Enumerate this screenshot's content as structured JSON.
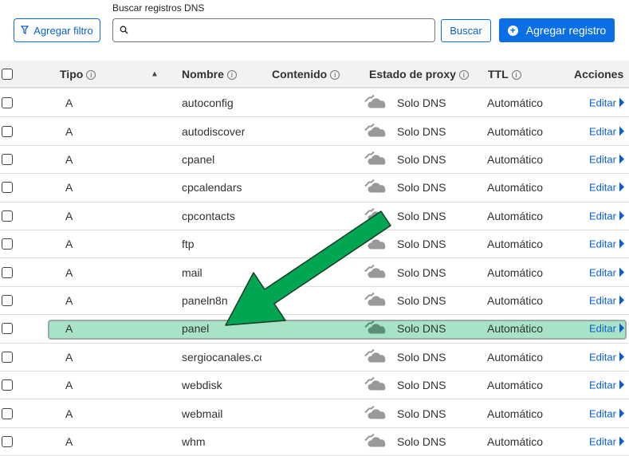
{
  "search": {
    "label": "Buscar registros DNS",
    "placeholder": "",
    "value": ""
  },
  "toolbar": {
    "filter_label": "Agregar filtro",
    "search_button": "Buscar",
    "add_label": "Agregar registro"
  },
  "colors": {
    "accent": "#0a6ee6",
    "highlight": "#a9e3c6",
    "arrow": "#00a651"
  },
  "table": {
    "headers": {
      "type": "Tipo",
      "name": "Nombre",
      "content": "Contenido",
      "proxy": "Estado de proxy",
      "ttl": "TTL",
      "actions": "Acciones"
    },
    "rows": [
      {
        "type": "A",
        "name": "autoconfig",
        "proxy": "Solo DNS",
        "ttl": "Automático",
        "action": "Editar"
      },
      {
        "type": "A",
        "name": "autodiscover",
        "proxy": "Solo DNS",
        "ttl": "Automático",
        "action": "Editar"
      },
      {
        "type": "A",
        "name": "cpanel",
        "proxy": "Solo DNS",
        "ttl": "Automático",
        "action": "Editar"
      },
      {
        "type": "A",
        "name": "cpcalendars",
        "proxy": "Solo DNS",
        "ttl": "Automático",
        "action": "Editar"
      },
      {
        "type": "A",
        "name": "cpcontacts",
        "proxy": "Solo DNS",
        "ttl": "Automático",
        "action": "Editar"
      },
      {
        "type": "A",
        "name": "ftp",
        "proxy": "Solo DNS",
        "ttl": "Automático",
        "action": "Editar"
      },
      {
        "type": "A",
        "name": "mail",
        "proxy": "Solo DNS",
        "ttl": "Automático",
        "action": "Editar"
      },
      {
        "type": "A",
        "name": "paneln8n",
        "proxy": "Solo DNS",
        "ttl": "Automático",
        "action": "Editar"
      },
      {
        "type": "A",
        "name": "panel",
        "proxy": "Solo DNS",
        "ttl": "Automático",
        "action": "Editar",
        "highlighted": true
      },
      {
        "type": "A",
        "name": "sergiocanales.co",
        "proxy": "Solo DNS",
        "ttl": "Automático",
        "action": "Editar"
      },
      {
        "type": "A",
        "name": "webdisk",
        "proxy": "Solo DNS",
        "ttl": "Automático",
        "action": "Editar"
      },
      {
        "type": "A",
        "name": "webmail",
        "proxy": "Solo DNS",
        "ttl": "Automático",
        "action": "Editar"
      },
      {
        "type": "A",
        "name": "whm",
        "proxy": "Solo DNS",
        "ttl": "Automático",
        "action": "Editar"
      }
    ]
  }
}
